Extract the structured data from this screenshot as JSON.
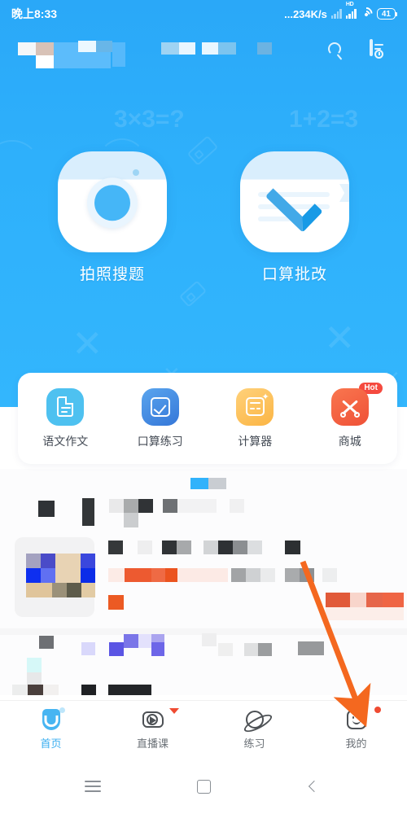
{
  "statusbar": {
    "time": "晚上8:33",
    "network_speed": "...234K/s",
    "hd_label": "HD",
    "battery": "41",
    "icons": [
      "signal-bars-icon",
      "hd-signal-icon",
      "wifi-icon",
      "battery-icon"
    ]
  },
  "header": {
    "title_censored": "",
    "search_icon": "search-icon",
    "history_icon": "history-document-icon"
  },
  "hero": {
    "watermarks": [
      "3×3=?",
      "1+2=3"
    ],
    "features": [
      {
        "label": "拍照搜题",
        "icon": "camera-icon"
      },
      {
        "label": "口算批改",
        "icon": "checkmark-icon"
      }
    ]
  },
  "quick_actions": [
    {
      "label": "语文作文",
      "icon": "document-icon",
      "color": "#4ec1f0",
      "badge": ""
    },
    {
      "label": "口算练习",
      "icon": "check-square-icon",
      "color": "#3d8ae0",
      "badge": ""
    },
    {
      "label": "计算器",
      "icon": "calculator-icon",
      "color": "#fcbe4f",
      "badge": ""
    },
    {
      "label": "商城",
      "icon": "mall-icon",
      "color": "#f4644a",
      "badge": "Hot"
    }
  ],
  "feed": {
    "censored": true,
    "note": ""
  },
  "tabbar": {
    "items": [
      {
        "label": "首页",
        "icon": "home-icon",
        "active": true,
        "badge": "none"
      },
      {
        "label": "直播课",
        "icon": "live-class-icon",
        "active": false,
        "badge": "triangle"
      },
      {
        "label": "练习",
        "icon": "practice-planet-icon",
        "active": false,
        "badge": "none"
      },
      {
        "label": "我的",
        "icon": "profile-smiley-icon",
        "active": false,
        "badge": "dot"
      }
    ],
    "active_color": "#3aaef0",
    "inactive_color": "#6b7177"
  },
  "navbar": {
    "items": [
      {
        "icon": "menu-recents-icon"
      },
      {
        "icon": "home-square-icon"
      },
      {
        "icon": "back-chevron-icon"
      }
    ]
  },
  "annotation": {
    "arrow_color": "#f4681f",
    "points_to": "我的"
  },
  "colors": {
    "hero_blue": "#2eb0fb",
    "accent": "#3aaef0",
    "badge_red": "#f54a3f",
    "arrow_orange": "#f4681f"
  }
}
